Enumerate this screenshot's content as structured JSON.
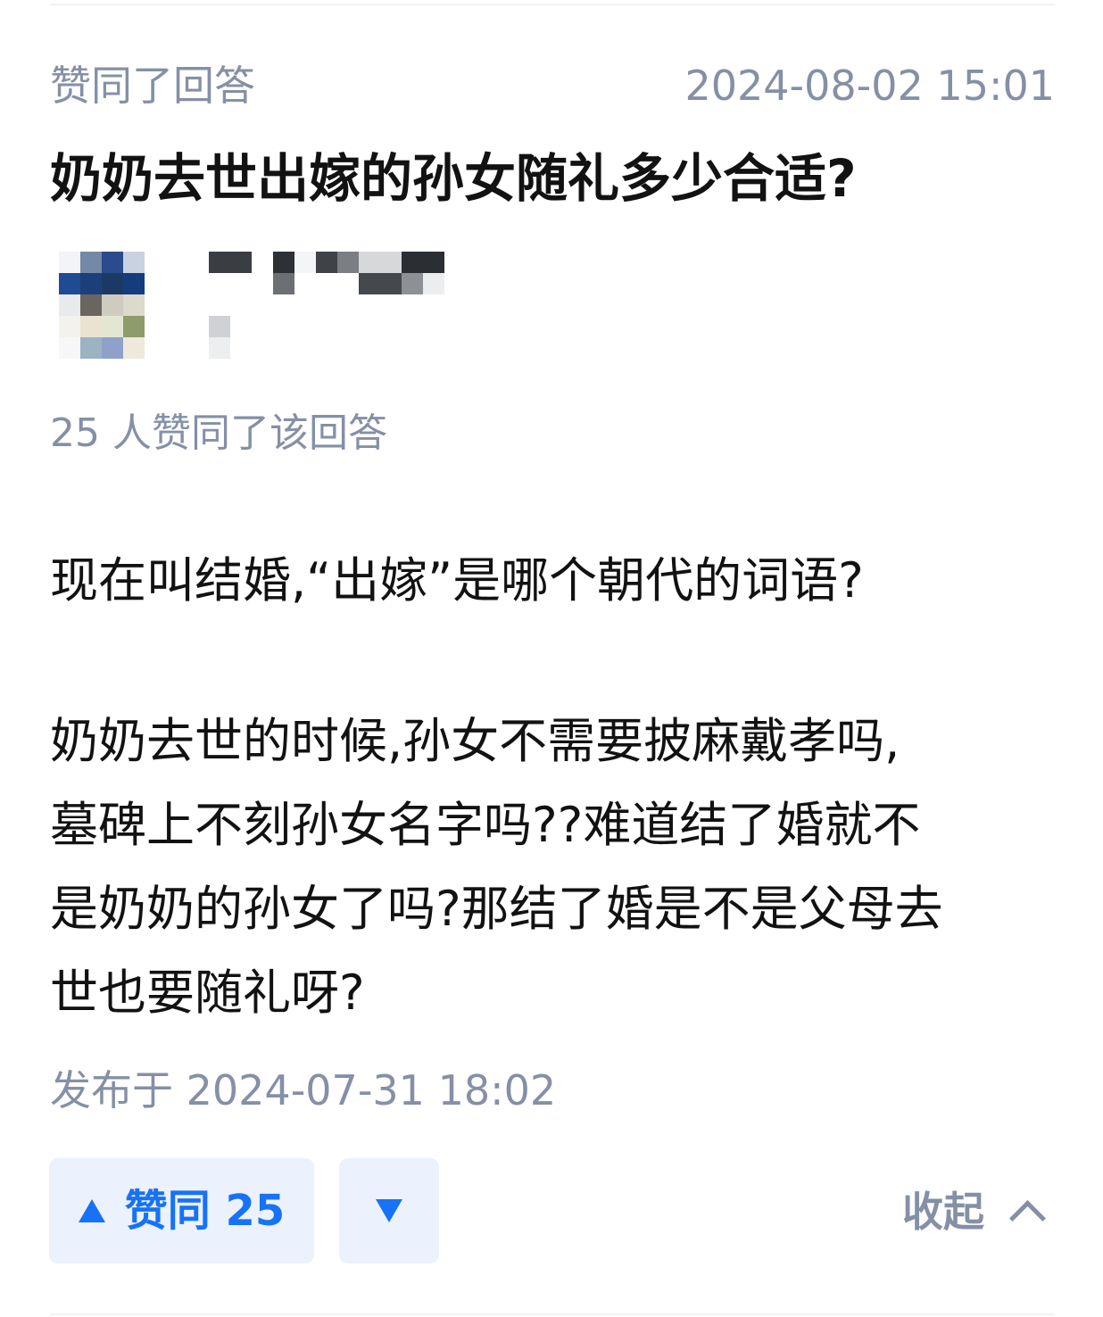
{
  "activity": {
    "label": "赞同了回答",
    "time": "2024-08-02 15:01"
  },
  "question": {
    "title": "奶奶去世出嫁的孙女随礼多少合适?"
  },
  "vote_summary": "25 人赞同了该回答",
  "content": {
    "paragraphs": [
      [
        "现在叫结婚,“出嫁”是哪个朝代的词语?"
      ],
      [
        "奶奶去世的时候,孙女不需要披麻戴孝吗,",
        "墓碑上不刻孙女名字吗??难道结了婚就不",
        "是奶奶的孙女了吗?那结了婚是不是父母去",
        "世也要随礼呀?"
      ]
    ]
  },
  "published": "发布于 2024-07-31 18:02",
  "actions": {
    "upvote_label": "赞同 25",
    "collapse_label": "收起",
    "accent_color": "#1772f6",
    "button_bg": "#ebf2fd",
    "muted_color": "#8590a6"
  },
  "icons": {
    "upvote": "triangle-up-icon",
    "downvote": "triangle-down-icon",
    "collapse": "chevron-up-icon"
  }
}
